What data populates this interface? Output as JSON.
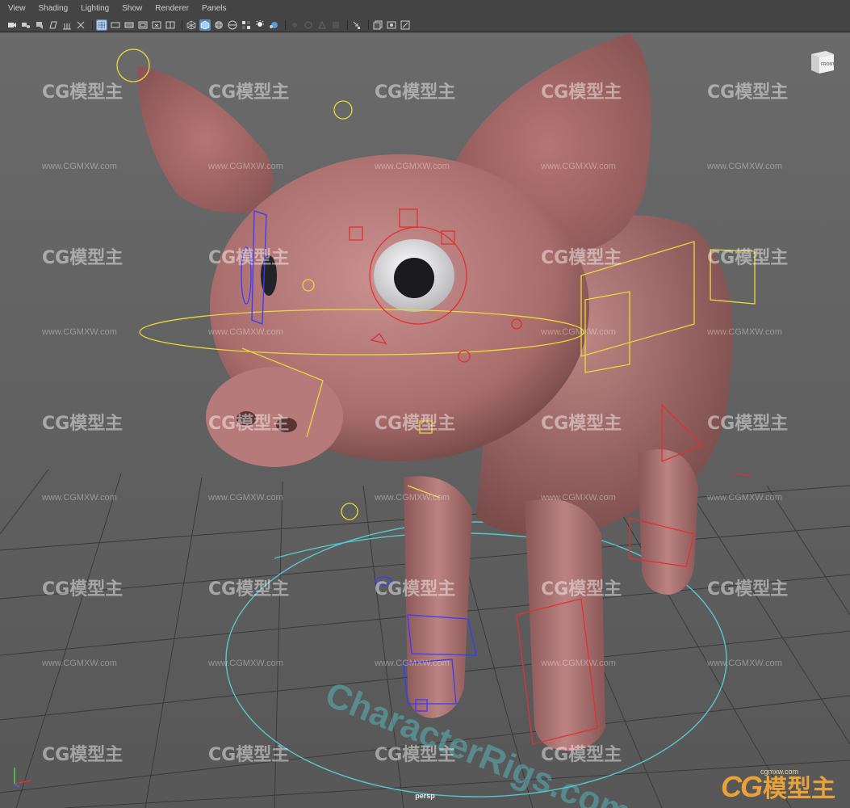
{
  "menubar": {
    "items": [
      "View",
      "Shading",
      "Lighting",
      "Show",
      "Renderer",
      "Panels"
    ]
  },
  "toolbar": {
    "icons": [
      "camera-icon",
      "camera-attributes-icon",
      "bookmark-icon",
      "image-plane-icon",
      "grid-icon",
      "film-gate-icon",
      "resolution-gate-icon",
      "gate-mask-icon",
      "field-chart-icon",
      "safe-action-icon",
      "safe-title-icon",
      "wireframe-icon",
      "smooth-shade-icon",
      "textured-icon",
      "use-lights-icon",
      "shadows-icon",
      "ambient-occlusion-icon",
      "motion-blur-icon",
      "isolate-select-icon",
      "xray-icon",
      "xray-joints-icon",
      "backface-icon",
      "two-panes-icon",
      "four-panes-icon",
      "single-pane-icon"
    ]
  },
  "viewport": {
    "camera_label": "persp",
    "viewcube_label": "FRONT",
    "watermark_cn": "CG模型主",
    "watermark_url": "www.CGMXW.com",
    "floor_text": "CharacterRigs.com"
  },
  "brand": {
    "cg": "CG",
    "cn": "模型主",
    "url": "cgmxw.com"
  },
  "colors": {
    "menu_bg": "#444444",
    "viewport": "#5d5d5d",
    "grid": "#3a3a3a",
    "pig_skin": "#b57a78",
    "control_yellow": "#e8d93a",
    "control_red": "#e23030",
    "control_blue": "#3a3aff",
    "control_cyan": "#57c6cf",
    "active_tool": "#5a86b8"
  }
}
